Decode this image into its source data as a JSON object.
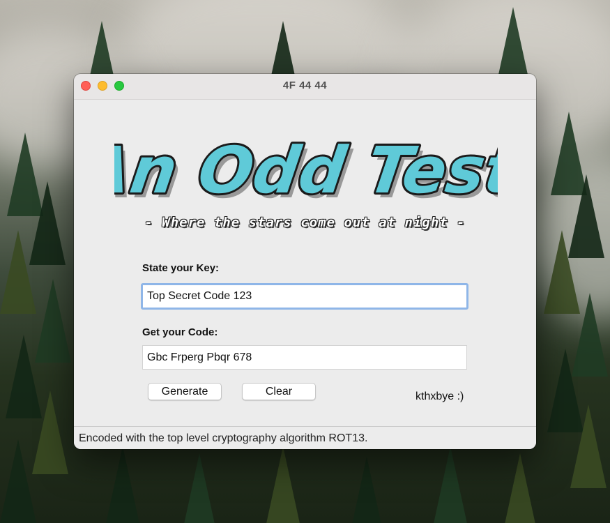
{
  "window": {
    "title": "4F 44 44"
  },
  "header": {
    "logo_text": "An Odd Test",
    "tagline": "- Where the stars come out at night -"
  },
  "form": {
    "key_label": "State your Key:",
    "key_value": "Top Secret Code 123",
    "code_label": "Get your Code:",
    "code_value": "Gbc Frperg Pbqr 678"
  },
  "buttons": {
    "generate_label": "Generate",
    "clear_label": "Clear"
  },
  "footer_note": "kthxbye :)",
  "status_bar": {
    "text": "Encoded with the top level cryptography algorithm ROT13."
  },
  "colors": {
    "logo_fill": "#5fcad8",
    "logo_outline": "#1b1b1b",
    "focus_ring": "#8fb6e8",
    "close": "#ff5f57",
    "minimize": "#febc2e",
    "maximize": "#28c840"
  }
}
